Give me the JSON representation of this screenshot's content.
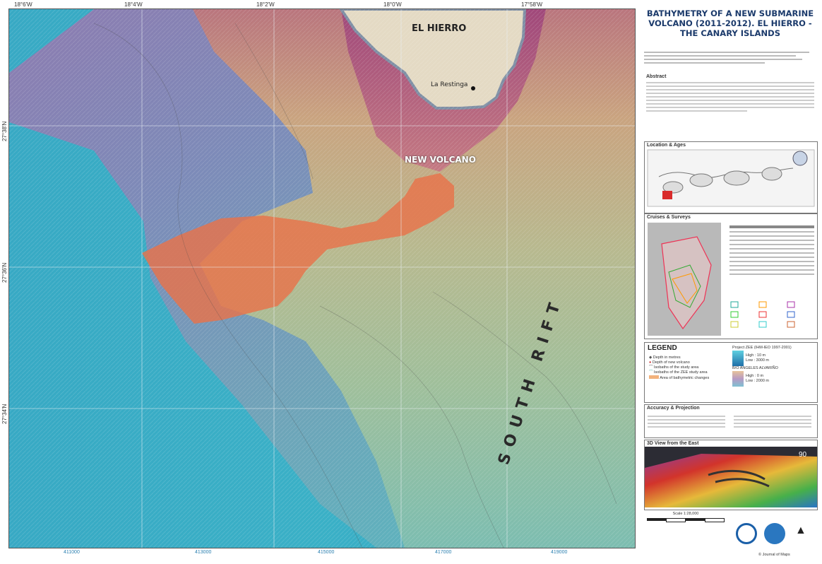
{
  "map": {
    "top_coords": [
      "18°6'W",
      "18°4'W",
      "18°2'W",
      "18°0'W",
      "17°58'W"
    ],
    "left_coords": [
      "27°38'N",
      "27°36'N",
      "27°34'N"
    ],
    "bottom_coords": [
      "411000",
      "413000",
      "415000",
      "417000",
      "419000"
    ],
    "labels": {
      "island": "EL HIERRO",
      "town": "La Restinga",
      "volcano": "NEW VOLCANO",
      "rift": "SOUTH RIFT"
    },
    "colors": {
      "deep": "#2aa7c9",
      "mid": "#7fb8a6",
      "shallow": "#c9a77a",
      "land": "#e4dac4",
      "new_material": "#e8734a"
    }
  },
  "panel": {
    "title": "BATHYMETRY OF A NEW SUBMARINE VOLCANO (2011-2012). EL HIERRO - THE CANARY ISLANDS",
    "sections": {
      "abstract": "Abstract",
      "location": "Location & Ages",
      "cruises": "Cruises & Surveys",
      "legend": "LEGEND",
      "accuracy": "Accuracy & Projection",
      "view3d": "3D View from the East"
    },
    "legend_items": [
      "Depth in metres",
      "Depth of new volcano",
      "Isobaths of the study area",
      "Isobaths of the ZEE study area",
      "Area of bathymetric changes"
    ],
    "legend_right": [
      "Project ZEE (IHM-IEO 1997-2001)",
      "High : 10 m",
      "Low : 3000 m",
      "B/O ANGELES ALVARIÑO",
      "High : 0 m",
      "Low : 2000 m"
    ],
    "view_number": "90",
    "scale_text": "Scale 1:28,000",
    "journal": "© Journal of Maps"
  }
}
